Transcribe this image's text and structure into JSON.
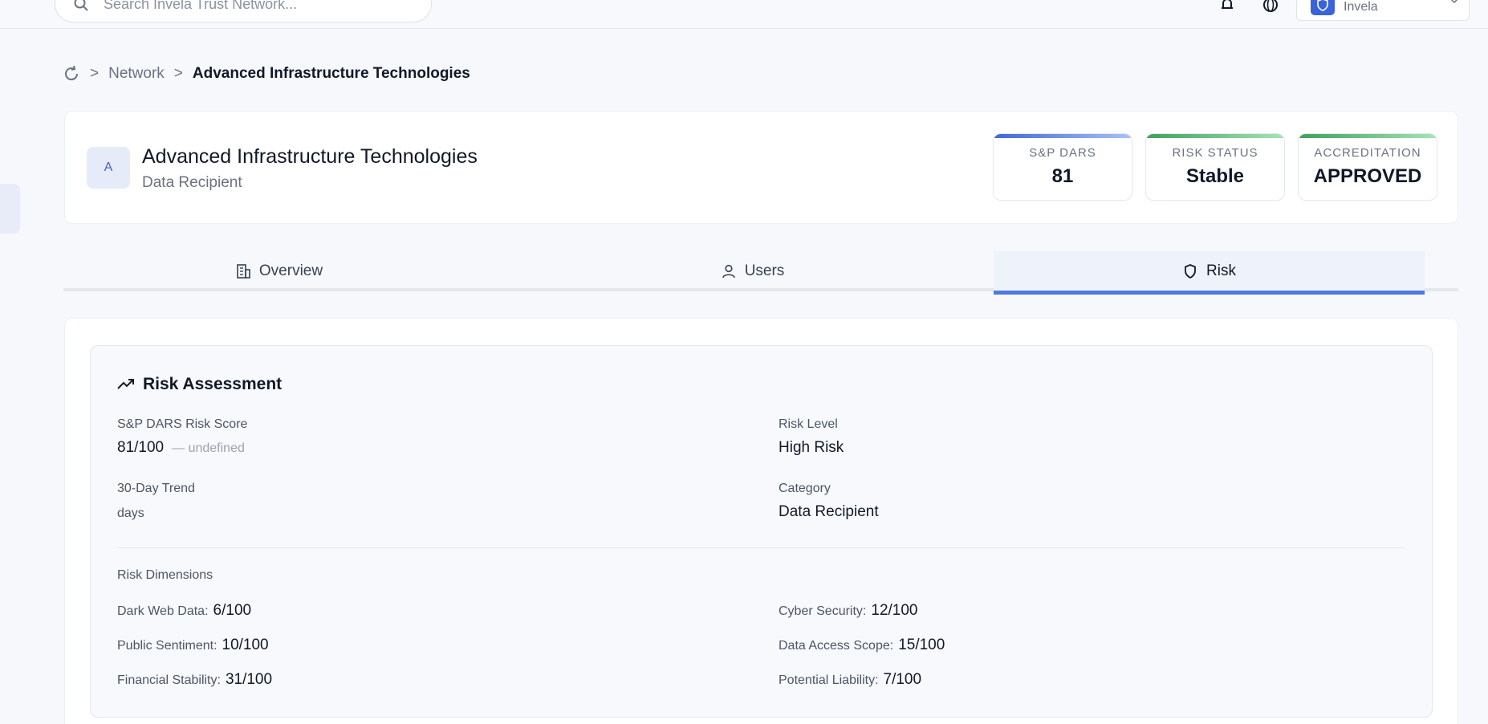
{
  "search": {
    "placeholder": "Search Invela Trust Network..."
  },
  "user": {
    "name": "Invela"
  },
  "breadcrumb": {
    "items": [
      "Network",
      "Advanced Infrastructure Technologies"
    ],
    "separator": ">"
  },
  "company": {
    "avatar_letter": "A",
    "name": "Advanced Infrastructure Technologies",
    "type": "Data Recipient"
  },
  "stats": [
    {
      "label": "S&P DARS",
      "value": "81",
      "color": "#4a72db"
    },
    {
      "label": "RISK STATUS",
      "value": "Stable",
      "color": "#4caf6a"
    },
    {
      "label": "ACCREDITATION",
      "value": "APPROVED",
      "color": "#4caf6a"
    }
  ],
  "tabs": [
    {
      "label": "Overview",
      "icon": "building-icon"
    },
    {
      "label": "Users",
      "icon": "user-icon"
    },
    {
      "label": "Risk",
      "icon": "shield-icon",
      "active": true
    }
  ],
  "risk": {
    "title": "Risk Assessment",
    "score_label": "S&P DARS Risk Score",
    "score_value": "81/100",
    "score_extra": "— undefined",
    "level_label": "Risk Level",
    "level_value": "High Risk",
    "trend_label": "30-Day Trend",
    "trend_value": "days",
    "category_label": "Category",
    "category_value": "Data Recipient",
    "dimensions_label": "Risk Dimensions",
    "dimensions": [
      {
        "label": "Dark Web Data:",
        "value": "6/100"
      },
      {
        "label": "Cyber Security:",
        "value": "12/100"
      },
      {
        "label": "Public Sentiment:",
        "value": "10/100"
      },
      {
        "label": "Data Access Scope:",
        "value": "15/100"
      },
      {
        "label": "Financial Stability:",
        "value": "31/100"
      },
      {
        "label": "Potential Liability:",
        "value": "7/100"
      }
    ]
  }
}
